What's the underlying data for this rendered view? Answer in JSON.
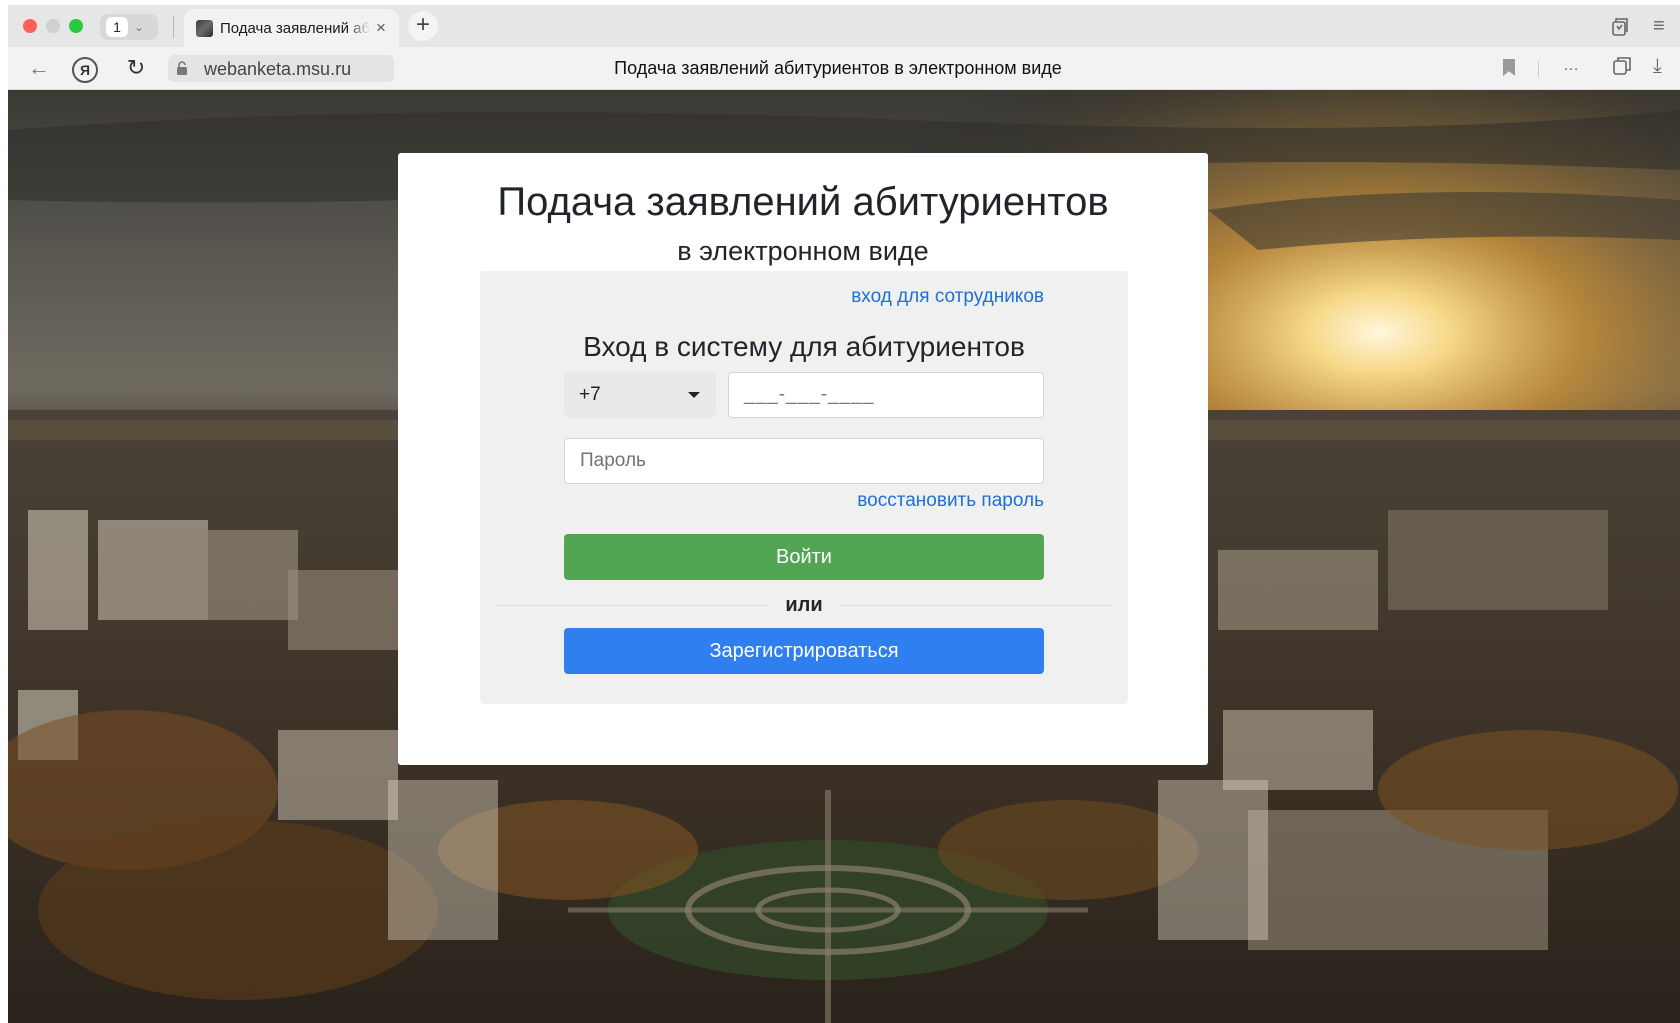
{
  "browser": {
    "tab_count": "1",
    "tab_title": "Подача заявлений аб",
    "tab_close": "×",
    "new_tab": "+",
    "url": "webanketa.msu.ru",
    "page_title": "Подача заявлений абитуриентов в электронном виде"
  },
  "page": {
    "title": "Подача заявлений абитуриентов",
    "subtitle": "в электронном виде",
    "staff_link": "вход для сотрудников",
    "login_heading": "Вход в систему для абитуриентов",
    "phone_code": "+7",
    "phone_placeholder": "___-___-____",
    "password_placeholder": "Пароль",
    "restore_link": "восстановить пароль",
    "login_button": "Войти",
    "or_text": "или",
    "register_button": "Зарегистрироваться"
  },
  "colors": {
    "login_button": "#52a552",
    "register_button": "#2f7ff0",
    "link": "#1e6fd9"
  },
  "icons": {
    "back": "back-arrow-icon",
    "yandex": "yandex-logo-icon",
    "reload": "reload-icon",
    "lock": "lock-icon",
    "bookmark": "bookmark-icon",
    "more": "more-icon",
    "extension": "extensions-icon",
    "download": "download-icon"
  }
}
